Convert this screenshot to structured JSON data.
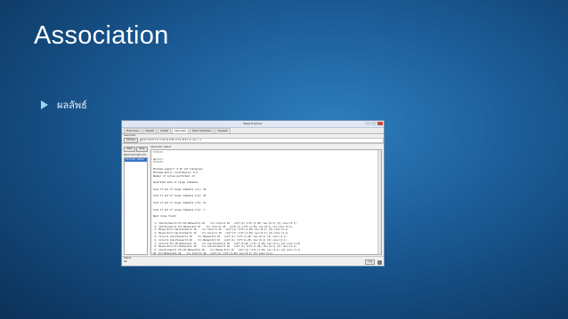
{
  "slide": {
    "title": "Association",
    "bullet": "ผลลัพธ์"
  },
  "weka": {
    "window_title": "Weka Explorer",
    "tabs": [
      "Preprocess",
      "Classify",
      "Cluster",
      "Associate",
      "Select attributes",
      "Visualize"
    ],
    "active_tab": "Associate",
    "associator_label": "Associator",
    "choose_label": "Choose",
    "command": "Apriori -N 10 -T 0 -C 0.9 -D 0.05 -U 1.0 -M 0.1 -S -1.0 -c -1",
    "start_label": "Start",
    "stop_label": "Stop",
    "result_list_label": "Result list (right-click fo",
    "result_item": "15:21:25 - Apriori",
    "output_label": "Associator output",
    "output_lines": [
      "=======",
      "",
      "Apriori",
      "=======",
      "",
      "Minimum support: 0.35 (10 instances)",
      "Minimum metric <confidence>: 0.9",
      "Number of cycles performed: 13",
      "",
      "Generated sets of large itemsets:",
      "",
      "Size of set of large itemsets L(1): 32",
      "",
      "Size of set of large itemsets L(2): 45",
      "",
      "Size of set of large itemsets L(3): 21",
      "",
      "Size of set of large itemsets L(4): 3",
      "",
      "Best rules found:",
      "",
      " 1. Com-Pioneer=2 Pri-Pk-Network=1 10    ==> Color=1 10   conf:(1) lift:(1.45) lev:(0.1) [3] conv:(3.1)",
      " 2. Com-Pioneer=1 Pri-Network=1 10    ==> Color=1 10   conf:(1) lift:(1.45) lev:(0.1) [3] conv:(3.1)",
      " 3. Mouse-Pc=1 Com-Pioneer=2 10    ==> Color=1 10   conf:(1) lift:(1.45) lev:(0.1) [3] conv:(3.1)",
      " 4. Mouse-Pc=1 Com-Pioneer=1 10    ==> Color=1 10   conf:(1) lift:(1.45) lev:(0.1) [3] conv:(3.1)",
      " 5. Color=1 Com-Pioneer=1 10    ==> Network=1 10   conf:(1) lift:(1.45) lev:(0.1) [3] conv:(3.1)",
      " 6. Color=1 Com-Pioneer=2 10    ==> Network=1 10   conf:(1) lift:(1.45) lev:(0.1) [3] conv:(3.1)",
      " 7. Color=1 Pri-Pk-Network=1 11    ==> Com-Pioneer=1 10   conf:(0.91) lift:(1.36) lev:(0.1) [2] conv:(1.8)",
      " 8. Mouse-Pc=1 Pri-Network=1 10    ==> Com-Pioneer=1 10   conf:(1) lift:(1.45) lev:(0.1) [3] conv:(3.1)",
      " 9. Com-Pioneer=1 Pri-Pk-Network=1 10    ==> Mouse-Pc=1 10   conf:(1) lift:(1.45) lev:(0.1) [3] conv:(3.1)",
      "10. Pri-Network=1 10    ==> Color=1 10   conf:(1) lift:(1.45) lev:(0.1) [3] conv:(3.1)"
    ],
    "status_label": "Status",
    "status_value": "OK",
    "log_label": "Log",
    "colors": {
      "slide_bg": "#1d5f9c",
      "bullet_arrow": "#9ed3f2",
      "selection": "#3d72c7"
    }
  }
}
